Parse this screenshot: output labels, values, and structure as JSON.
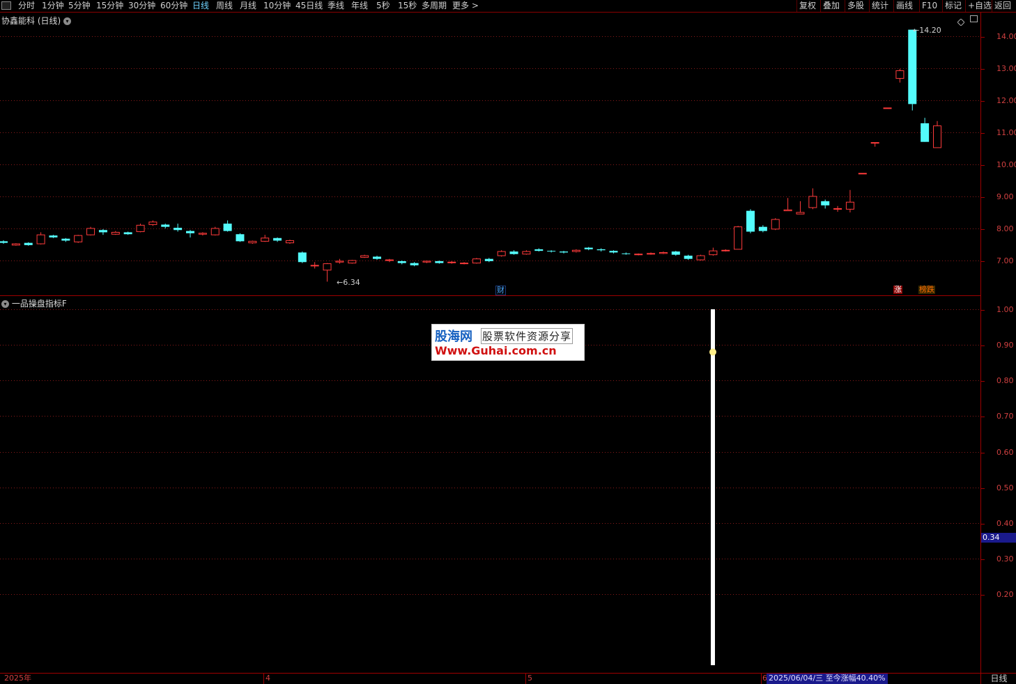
{
  "toolbar": {
    "periods": [
      "分时",
      "1分钟",
      "5分钟",
      "15分钟",
      "30分钟",
      "60分钟",
      "日线",
      "周线",
      "月线",
      "10分钟",
      "45日线",
      "季线",
      "年线",
      "5秒",
      "15秒",
      "多周期",
      "更多 >"
    ],
    "active_period": "日线",
    "actions": [
      "复权",
      "叠加",
      "多股",
      "统计",
      "画线",
      "F10",
      "标记",
      "+自选",
      "返回"
    ]
  },
  "main_panel": {
    "title": "协鑫能科 (日线)",
    "high_label": "14.20",
    "low_label": "6.34",
    "markers": [
      "财",
      "涨",
      "榜跌"
    ]
  },
  "indicator_panel": {
    "title": "一品操盘指标F",
    "current_value": "0.34"
  },
  "watermark": {
    "brand": "股海网",
    "slogan": "股票软件资源分享",
    "url": "Www.Guhai.com.cn"
  },
  "bottom": {
    "year_label": "2025年",
    "month_labels": [
      "4",
      "5",
      "6"
    ],
    "status": "2025/06/04/三 至今涨幅40.40%",
    "tab": "日线"
  },
  "colors": {
    "up": "#ff3b3b",
    "down": "#54fcfc",
    "axis": "#d04040",
    "grid": "#8b1a1a",
    "indicator_line": "#ffffff"
  },
  "chart_data": [
    {
      "type": "candlestick",
      "title": "协鑫能科 (日线)",
      "ylim": [
        6.0,
        14.3
      ],
      "yticks": [
        7.0,
        8.0,
        9.0,
        10.0,
        11.0,
        12.0,
        13.0,
        14.0
      ],
      "ytick_labels": [
        "7.00",
        "8.00",
        "9.00",
        "10.00",
        "11.00",
        "12.00",
        "13.00",
        "14.00"
      ],
      "x_labels": [
        "2025年",
        "4",
        "5",
        "6"
      ],
      "candles": [
        [
          7.6,
          7.55,
          7.63,
          7.52
        ],
        [
          7.48,
          7.52,
          7.54,
          7.46
        ],
        [
          7.55,
          7.48,
          7.57,
          7.46
        ],
        [
          7.52,
          7.8,
          7.88,
          7.5
        ],
        [
          7.78,
          7.72,
          7.8,
          7.7
        ],
        [
          7.68,
          7.62,
          7.7,
          7.58
        ],
        [
          7.58,
          7.78,
          7.8,
          7.55
        ],
        [
          7.8,
          8.0,
          8.05,
          7.78
        ],
        [
          7.95,
          7.88,
          7.98,
          7.8
        ],
        [
          7.82,
          7.88,
          7.92,
          7.8
        ],
        [
          7.88,
          7.82,
          7.9,
          7.8
        ],
        [
          7.9,
          8.1,
          8.15,
          7.88
        ],
        [
          8.12,
          8.2,
          8.25,
          8.08
        ],
        [
          8.12,
          8.05,
          8.15,
          8.0
        ],
        [
          8.02,
          7.95,
          8.15,
          7.9
        ],
        [
          7.92,
          7.85,
          7.95,
          7.72
        ],
        [
          7.82,
          7.85,
          7.88,
          7.78
        ],
        [
          7.8,
          8.0,
          8.05,
          7.78
        ],
        [
          8.15,
          7.92,
          8.25,
          7.9
        ],
        [
          7.82,
          7.6,
          7.85,
          7.58
        ],
        [
          7.55,
          7.6,
          7.62,
          7.52
        ],
        [
          7.6,
          7.7,
          7.8,
          7.58
        ],
        [
          7.7,
          7.62,
          7.72,
          7.58
        ],
        [
          7.55,
          7.62,
          7.65,
          7.52
        ],
        [
          7.25,
          6.95,
          7.28,
          6.92
        ],
        [
          6.85,
          6.85,
          6.95,
          6.75
        ],
        [
          6.7,
          6.9,
          6.92,
          6.34
        ],
        [
          6.95,
          6.98,
          7.05,
          6.9
        ],
        [
          6.92,
          7.0,
          7.02,
          6.9
        ],
        [
          7.1,
          7.15,
          7.18,
          7.08
        ],
        [
          7.12,
          7.05,
          7.15,
          7.02
        ],
        [
          7.0,
          7.02,
          7.05,
          6.95
        ],
        [
          6.98,
          6.92,
          7.0,
          6.88
        ],
        [
          6.92,
          6.85,
          6.95,
          6.82
        ],
        [
          6.95,
          6.98,
          7.0,
          6.92
        ],
        [
          6.98,
          6.92,
          7.0,
          6.9
        ],
        [
          6.95,
          6.95,
          6.98,
          6.9
        ],
        [
          6.92,
          6.92,
          6.95,
          6.88
        ],
        [
          6.92,
          7.05,
          7.08,
          6.9
        ],
        [
          7.05,
          6.98,
          7.08,
          6.95
        ],
        [
          7.15,
          7.28,
          7.32,
          7.12
        ],
        [
          7.28,
          7.2,
          7.32,
          7.18
        ],
        [
          7.2,
          7.28,
          7.32,
          7.18
        ],
        [
          7.35,
          7.3,
          7.38,
          7.28
        ],
        [
          7.3,
          7.28,
          7.32,
          7.25
        ],
        [
          7.28,
          7.25,
          7.3,
          7.22
        ],
        [
          7.28,
          7.32,
          7.35,
          7.25
        ],
        [
          7.4,
          7.35,
          7.42,
          7.32
        ],
        [
          7.35,
          7.32,
          7.38,
          7.28
        ],
        [
          7.3,
          7.25,
          7.32,
          7.22
        ],
        [
          7.22,
          7.2,
          7.25,
          7.18
        ],
        [
          7.18,
          7.2,
          7.22,
          7.16
        ],
        [
          7.2,
          7.22,
          7.25,
          7.18
        ],
        [
          7.22,
          7.25,
          7.28,
          7.2
        ],
        [
          7.28,
          7.18,
          7.3,
          7.15
        ],
        [
          7.15,
          7.05,
          7.18,
          7.02
        ],
        [
          7.02,
          7.15,
          7.18,
          7.0
        ],
        [
          7.18,
          7.3,
          7.4,
          7.15
        ],
        [
          7.3,
          7.32,
          7.35,
          7.28
        ],
        [
          7.35,
          8.05,
          8.08,
          7.35
        ],
        [
          8.55,
          7.9,
          8.6,
          7.85
        ],
        [
          8.05,
          7.92,
          8.1,
          7.88
        ],
        [
          7.98,
          8.28,
          8.32,
          7.95
        ],
        [
          8.55,
          8.58,
          8.95,
          8.55
        ],
        [
          8.45,
          8.5,
          8.85,
          8.45
        ],
        [
          8.65,
          9.0,
          9.25,
          8.6
        ],
        [
          8.85,
          8.72,
          8.9,
          8.62
        ],
        [
          8.62,
          8.62,
          8.7,
          8.52
        ],
        [
          8.6,
          8.82,
          9.2,
          8.5
        ],
        [
          9.72,
          9.72,
          9.72,
          9.72
        ],
        [
          10.68,
          10.68,
          10.68,
          10.55
        ],
        [
          11.76,
          11.76,
          11.76,
          11.76
        ],
        [
          12.68,
          12.92,
          12.98,
          12.55
        ],
        [
          14.2,
          11.88,
          14.2,
          11.68
        ],
        [
          11.28,
          10.7,
          11.45,
          10.7
        ],
        [
          10.52,
          11.2,
          11.35,
          10.52
        ]
      ]
    },
    {
      "type": "bar",
      "title": "一品操盘指标F",
      "ylim": [
        0.12,
        1.05
      ],
      "yticks": [
        0.2,
        0.3,
        0.4,
        0.5,
        0.6,
        0.7,
        0.8,
        0.9,
        1.0
      ],
      "ytick_labels": [
        "0.20",
        "0.30",
        "0.40",
        "0.50",
        "0.60",
        "0.70",
        "0.80",
        "0.90",
        "1.00"
      ],
      "signal_bar": {
        "from": 0.0,
        "to": 1.0,
        "dot_value": 0.88
      },
      "current_value": 0.34
    }
  ]
}
